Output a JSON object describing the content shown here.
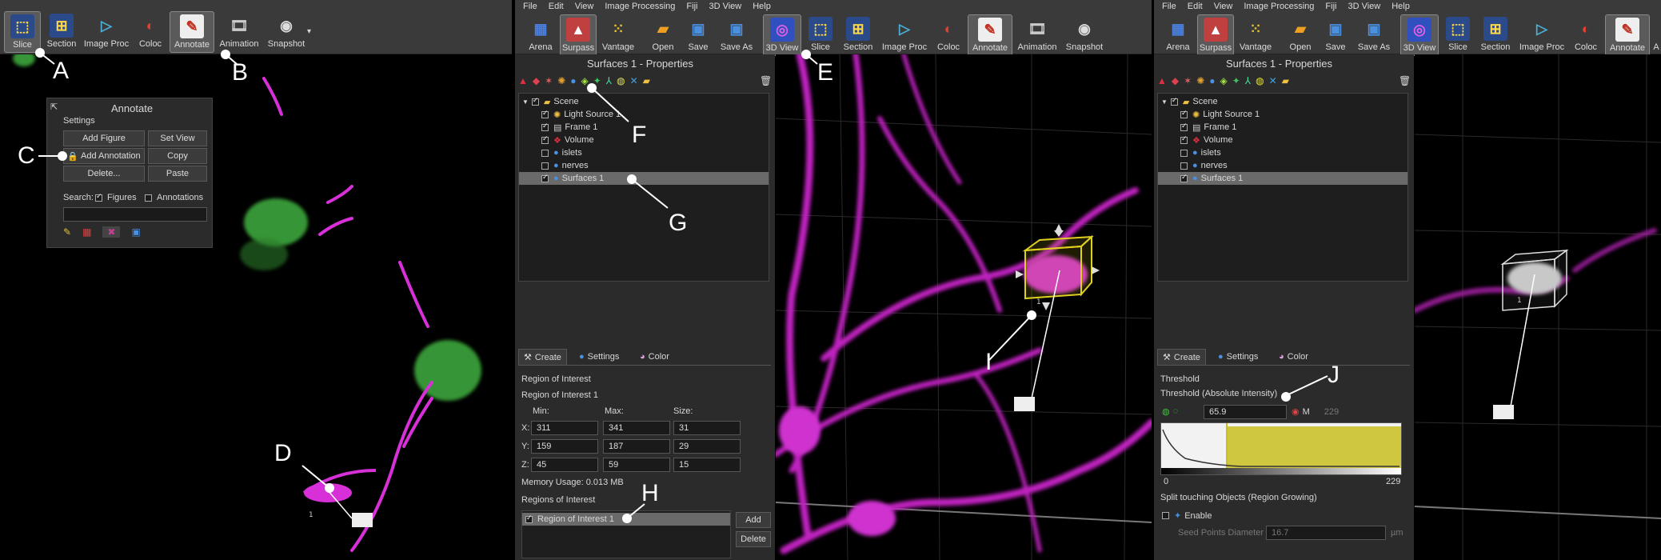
{
  "left_toolbar": {
    "buttons": [
      {
        "label": "Slice",
        "icon": "slice-icon"
      },
      {
        "label": "Section",
        "icon": "section-icon"
      },
      {
        "label": "Image Proc",
        "icon": "image-proc-icon"
      },
      {
        "label": "Coloc",
        "icon": "coloc-icon"
      },
      {
        "label": "Annotate",
        "icon": "annotate-icon"
      },
      {
        "label": "Animation",
        "icon": "animation-icon"
      },
      {
        "label": "Snapshot",
        "icon": "snapshot-icon"
      }
    ]
  },
  "annotate_panel": {
    "title": "Annotate",
    "settings_label": "Settings",
    "add_figure": "Add Figure",
    "set_view": "Set View",
    "add_annotation": "Add Annotation",
    "copy": "Copy",
    "delete": "Delete...",
    "paste": "Paste",
    "search_label": "Search:",
    "figures_label": "Figures",
    "annotations_label": "Annotations"
  },
  "menu": [
    "File",
    "Edit",
    "View",
    "Image Processing",
    "Fiji",
    "3D View",
    "Help"
  ],
  "mid_toolbar": {
    "buttons": [
      {
        "label": "Arena",
        "icon": "arena-icon"
      },
      {
        "label": "Surpass",
        "icon": "surpass-icon"
      },
      {
        "label": "Vantage",
        "icon": "vantage-icon"
      },
      {
        "label": "Open",
        "icon": "open-folder-icon"
      },
      {
        "label": "Save",
        "icon": "save-icon"
      },
      {
        "label": "Save As",
        "icon": "save-as-icon"
      },
      {
        "label": "3D View",
        "icon": "3d-view-icon"
      },
      {
        "label": "Slice",
        "icon": "slice-icon"
      },
      {
        "label": "Section",
        "icon": "section-icon"
      },
      {
        "label": "Image Proc",
        "icon": "image-proc-icon"
      },
      {
        "label": "Coloc",
        "icon": "coloc-icon"
      },
      {
        "label": "Annotate",
        "icon": "annotate-icon"
      },
      {
        "label": "Animation",
        "icon": "animation-icon"
      },
      {
        "label": "Snapshot",
        "icon": "snapshot-icon"
      }
    ]
  },
  "right_toolbar": {
    "buttons": [
      {
        "label": "Arena"
      },
      {
        "label": "Surpass"
      },
      {
        "label": "Vantage"
      },
      {
        "label": "Open"
      },
      {
        "label": "Save"
      },
      {
        "label": "Save As"
      },
      {
        "label": "3D View"
      },
      {
        "label": "Slice"
      },
      {
        "label": "Section"
      },
      {
        "label": "Image Proc"
      },
      {
        "label": "Coloc"
      },
      {
        "label": "Annotate"
      },
      {
        "label": "A"
      }
    ]
  },
  "props_title": "Surfaces 1 - Properties",
  "scene_tree": {
    "items": [
      {
        "label": "Scene",
        "checked": true
      },
      {
        "label": "Light Source 1",
        "checked": true
      },
      {
        "label": "Frame 1",
        "checked": true
      },
      {
        "label": "Volume",
        "checked": true
      },
      {
        "label": "islets",
        "checked": false
      },
      {
        "label": "nerves",
        "checked": false
      },
      {
        "label": "Surfaces 1",
        "checked": true
      }
    ]
  },
  "tabs": {
    "create": "Create",
    "settings": "Settings",
    "color": "Color"
  },
  "roi": {
    "heading": "Region of Interest",
    "name": "Region of Interest 1",
    "min_label": "Min:",
    "max_label": "Max:",
    "size_label": "Size:",
    "x_label": "X:",
    "y_label": "Y:",
    "z_label": "Z:",
    "x": {
      "min": "311",
      "max": "341",
      "size": "31"
    },
    "y": {
      "min": "159",
      "max": "187",
      "size": "29"
    },
    "z": {
      "min": "45",
      "max": "59",
      "size": "15"
    },
    "memory": "Memory Usage: 0.013 MB",
    "list_label": "Regions of Interest",
    "list_item": "Region of Interest 1",
    "add": "Add",
    "delete": "Delete"
  },
  "threshold": {
    "heading": "Threshold",
    "sub": "Threshold (Absolute Intensity)",
    "value": "65.9",
    "max_label": "M",
    "max_value": "229",
    "hist_min": "0",
    "hist_max": "229",
    "split_heading": "Split touching Objects (Region Growing)",
    "enable": "Enable",
    "seed_label": "Seed Points Diameter",
    "seed_value": "16.7",
    "seed_unit": "µm"
  },
  "scene_label": "1",
  "callouts": [
    "A",
    "B",
    "C",
    "D",
    "E",
    "F",
    "G",
    "H",
    "I",
    "J"
  ],
  "colors": {
    "magenta": "#e030e0",
    "green": "#40c040",
    "yellow": "#c8c020",
    "accent": "#5a5a5a"
  }
}
